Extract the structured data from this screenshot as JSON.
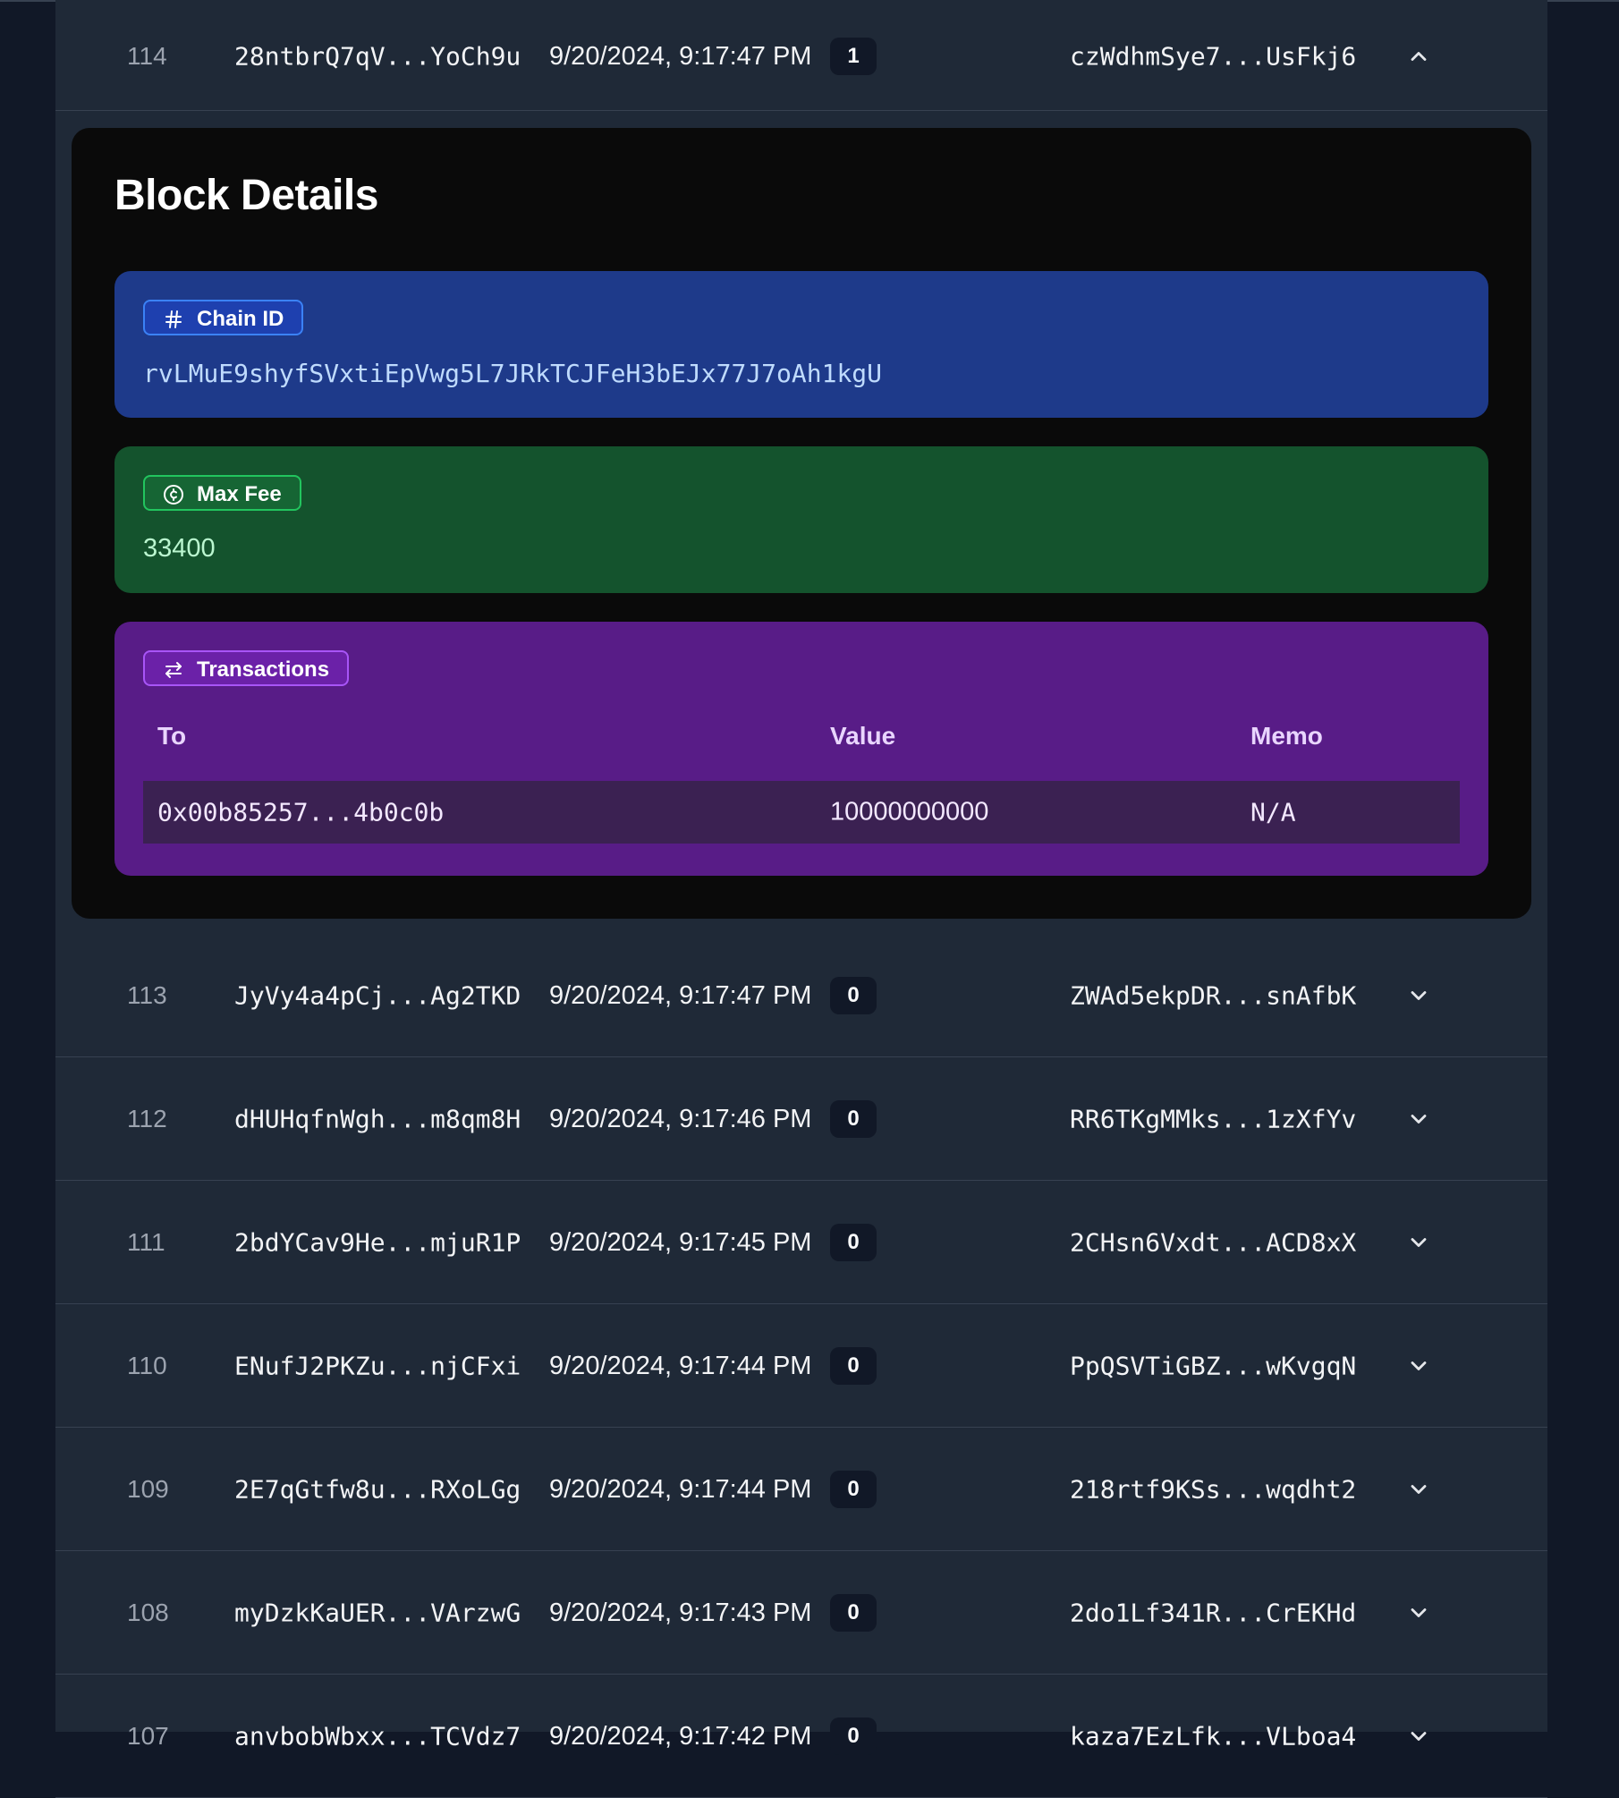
{
  "blocks_before": [
    {
      "number": "114",
      "hash": "28ntbrQ7qV...YoCh9u",
      "time": "9/20/2024, 9:17:47 PM",
      "tx_count": "1",
      "miner": "czWdhmSye7...UsFkj6",
      "expanded": true
    }
  ],
  "details": {
    "title": "Block Details",
    "chain_id_label": "Chain ID",
    "chain_id_value": "rvLMuE9shyfSVxtiEpVwg5L7JRkTCJFeH3bEJx77J7oAh1kgU",
    "max_fee_label": "Max Fee",
    "max_fee_value": "33400",
    "transactions_label": "Transactions",
    "columns": {
      "to": "To",
      "value": "Value",
      "memo": "Memo"
    },
    "transactions": [
      {
        "to": "0x00b85257...4b0c0b",
        "value": "10000000000",
        "memo": "N/A"
      }
    ]
  },
  "blocks_after": [
    {
      "number": "113",
      "hash": "JyVy4a4pCj...Ag2TKD",
      "time": "9/20/2024, 9:17:47 PM",
      "tx_count": "0",
      "miner": "ZWAd5ekpDR...snAfbK"
    },
    {
      "number": "112",
      "hash": "dHUHqfnWgh...m8qm8H",
      "time": "9/20/2024, 9:17:46 PM",
      "tx_count": "0",
      "miner": "RR6TKgMMks...1zXfYv"
    },
    {
      "number": "111",
      "hash": "2bdYCav9He...mjuR1P",
      "time": "9/20/2024, 9:17:45 PM",
      "tx_count": "0",
      "miner": "2CHsn6Vxdt...ACD8xX"
    },
    {
      "number": "110",
      "hash": "ENufJ2PKZu...njCFxi",
      "time": "9/20/2024, 9:17:44 PM",
      "tx_count": "0",
      "miner": "PpQSVTiGBZ...wKvgqN"
    },
    {
      "number": "109",
      "hash": "2E7qGtfw8u...RXoLGg",
      "time": "9/20/2024, 9:17:44 PM",
      "tx_count": "0",
      "miner": "218rtf9KSs...wqdht2"
    },
    {
      "number": "108",
      "hash": "myDzkKaUER...VArzwG",
      "time": "9/20/2024, 9:17:43 PM",
      "tx_count": "0",
      "miner": "2do1Lf341R...CrEKHd"
    },
    {
      "number": "107",
      "hash": "anvbobWbxx...TCVdz7",
      "time": "9/20/2024, 9:17:42 PM",
      "tx_count": "0",
      "miner": "kaza7EzLfk...VLboa4"
    }
  ]
}
